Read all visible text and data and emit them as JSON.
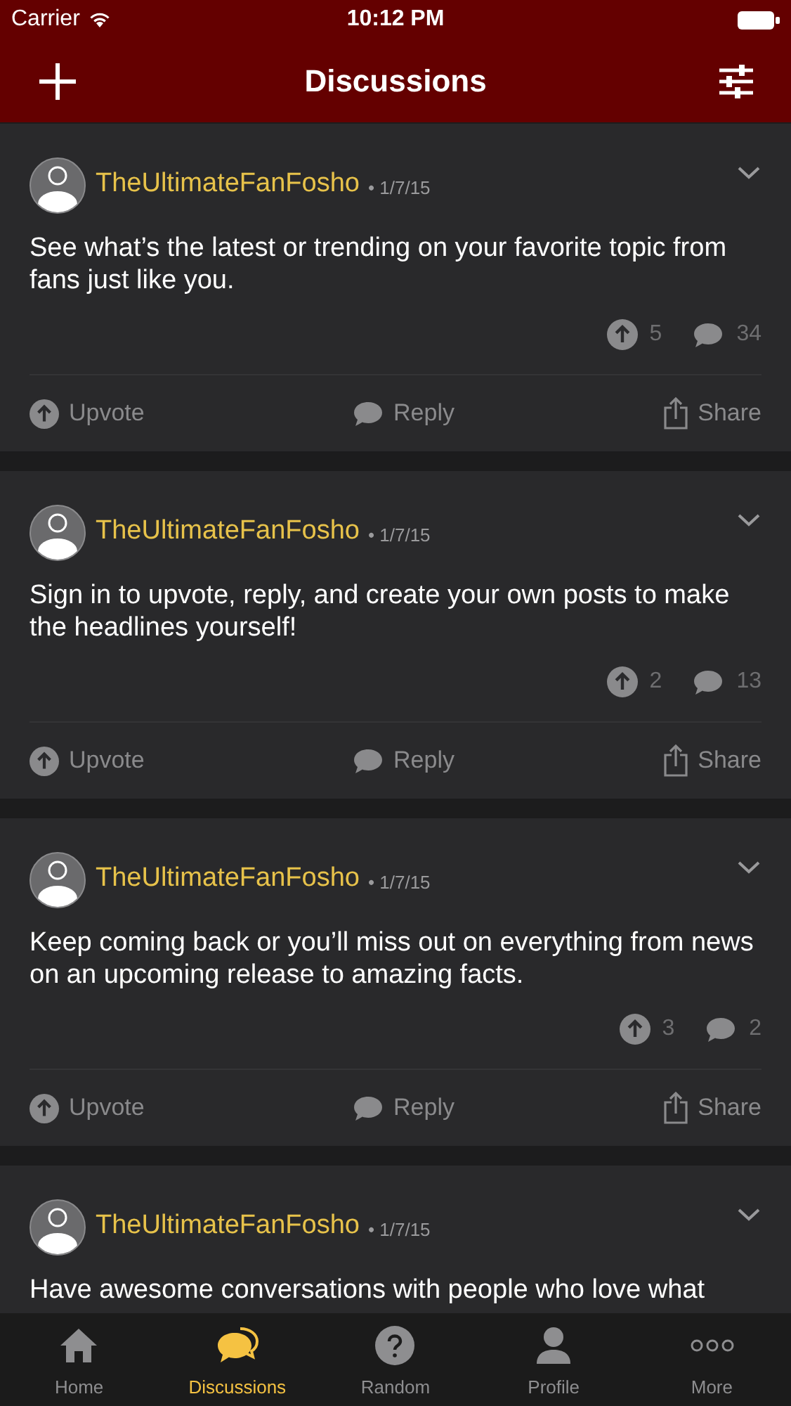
{
  "status_bar": {
    "carrier": "Carrier",
    "time": "10:12 PM"
  },
  "nav_bar": {
    "title": "Discussions"
  },
  "posts": [
    {
      "author": "TheUltimateFanFosho",
      "date": "• 1/7/15",
      "text": "See what’s the latest or trending on your favorite topic from fans just like you.",
      "upvotes": "5",
      "replies": "34",
      "actions": [
        "Upvote",
        "Reply",
        "Share"
      ]
    },
    {
      "author": "TheUltimateFanFosho",
      "date": "• 1/7/15",
      "text": "Sign in to upvote, reply, and create your own posts to make the headlines yourself!",
      "upvotes": "2",
      "replies": "13",
      "actions": [
        "Upvote",
        "Reply",
        "Share"
      ]
    },
    {
      "author": "TheUltimateFanFosho",
      "date": "• 1/7/15",
      "text": "Keep coming back or you’ll miss out on everything from news on an upcoming release to amazing facts.",
      "upvotes": "3",
      "replies": "2",
      "actions": [
        "Upvote",
        "Reply",
        "Share"
      ]
    },
    {
      "author": "TheUltimateFanFosho",
      "date": "• 1/7/15",
      "text": "Have awesome conversations with people who love what"
    }
  ],
  "tab_bar": [
    {
      "label": "Home",
      "kind": "home",
      "selected": false
    },
    {
      "label": "Discussions",
      "kind": "discussions",
      "selected": true
    },
    {
      "label": "Random",
      "kind": "random",
      "selected": false
    },
    {
      "label": "Profile",
      "kind": "profile",
      "selected": false
    },
    {
      "label": "More",
      "kind": "more",
      "selected": false
    }
  ]
}
